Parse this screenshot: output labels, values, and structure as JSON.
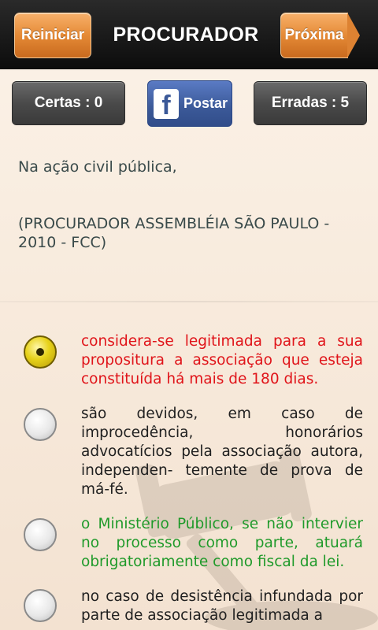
{
  "header": {
    "restart_label": "Reiniciar",
    "title": "PROCURADOR",
    "next_label": "Próxima"
  },
  "score": {
    "correct_label": "Certas : 0",
    "wrong_label": "Erradas : 5",
    "share_label": "Postar",
    "share_logo": "f"
  },
  "question": {
    "text": "Na ação civil pública,",
    "source": "(PROCURADOR ASSEMBLÉIA SÃO PAULO - 2010 - FCC)"
  },
  "options": [
    {
      "text": "considera-se legitimada para a sua propositura a associação que esteja constituída há mais de 180 dias.",
      "selected": true,
      "color": "#e0141a"
    },
    {
      "text": "são devidos, em caso de improcedência, honorários advocatícios pela associação autora, independen- temente de prova de má-fé.",
      "selected": false,
      "color": "#202020"
    },
    {
      "text": "o Ministério Público, se não intervier no processo como parte, atuará obrigatoriamente como fiscal da lei.",
      "selected": false,
      "color": "#1f9a2a"
    },
    {
      "text": "no caso de desistência infundada por parte de associação legitimada a",
      "selected": false,
      "color": "#202020"
    }
  ],
  "icons": {
    "share": "facebook-icon",
    "background": "gavel-icon",
    "radio": "radio-button-icon"
  }
}
